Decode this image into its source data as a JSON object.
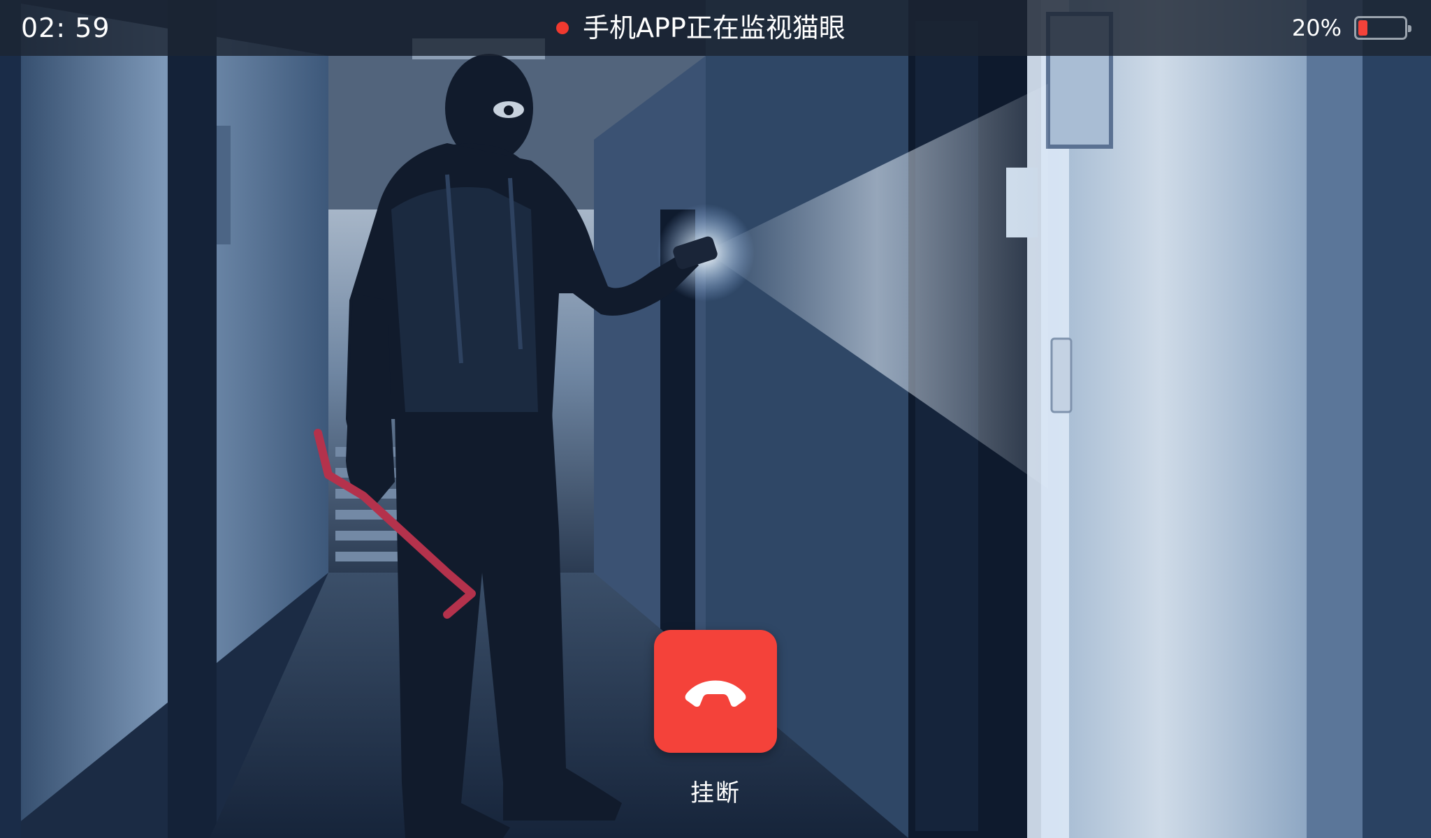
{
  "call": {
    "timer": "02: 59",
    "status_text": "手机APP正在监视猫眼",
    "hangup_label": "挂断"
  },
  "battery": {
    "percent_text": "20%",
    "level": 0.2
  },
  "colors": {
    "accent_red": "#f4423a",
    "recording_dot": "#f0392f",
    "battery_low": "#f4423a"
  },
  "icons": {
    "hangup": "phone-hangup-icon",
    "recording": "recording-dot-icon",
    "battery": "battery-icon"
  }
}
